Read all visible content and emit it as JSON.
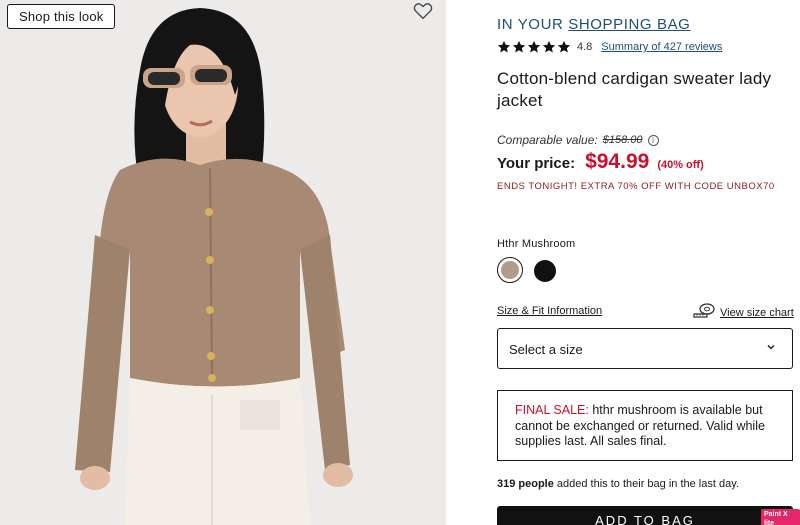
{
  "image": {
    "alt": "Model wearing cotton-blend cardigan sweater lady jacket",
    "shop_look_label": "Shop this look"
  },
  "header": {
    "bag_prefix": "IN YOUR",
    "bag_link": "SHOPPING BAG"
  },
  "rating": {
    "stars": 5,
    "value": "4.8",
    "reviews_link": "Summary of 427 reviews"
  },
  "product": {
    "title": "Cotton-blend cardigan sweater lady jacket"
  },
  "pricing": {
    "comparable_label": "Comparable value:",
    "comparable_value": "$158.00",
    "your_price_label": "Your price:",
    "price": "$94.99",
    "discount": "(40% off)",
    "promo": "ENDS TONIGHT! EXTRA 70% OFF WITH CODE UNBOX70"
  },
  "color": {
    "label": "Hthr Mushroom",
    "swatches": [
      {
        "name": "Hthr Mushroom",
        "hex": "#b09a8a",
        "selected": true
      },
      {
        "name": "Black",
        "hex": "#111111",
        "selected": false
      }
    ]
  },
  "size": {
    "fit_link": "Size & Fit Information",
    "chart_link": "View size chart",
    "select_placeholder": "Select a size"
  },
  "final_sale": {
    "prefix": "FINAL SALE:",
    "message": " hthr mushroom is available but cannot be exchanged or returned. Valid while supplies last. All sales final."
  },
  "social_proof": {
    "count": "319 people",
    "text": " added this to their bag in the last day."
  },
  "cta": {
    "add_to_bag": "ADD TO BAG"
  },
  "badge": {
    "label": "Paint X lite"
  },
  "colors": {
    "accent_blue": "#1f4e79",
    "sale_red": "#c8102e"
  }
}
